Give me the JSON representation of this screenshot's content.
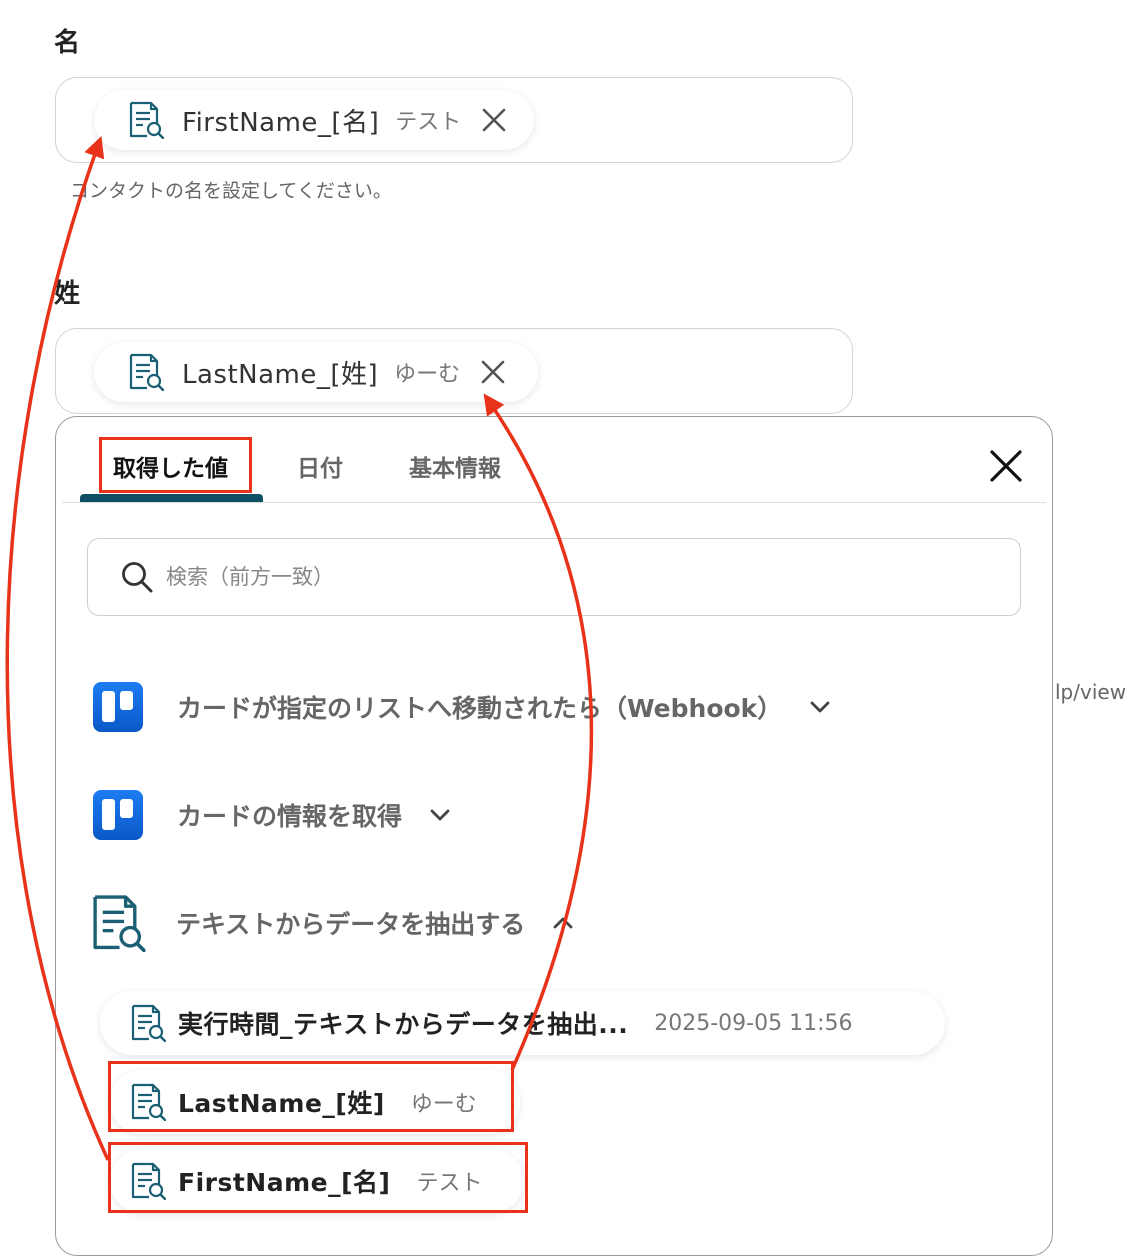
{
  "fields": {
    "first_name": {
      "label": "名",
      "chip_name": "FirstName_[名]",
      "chip_value": "テスト",
      "help": "コンタクトの名を設定してください。"
    },
    "last_name": {
      "label": "姓",
      "chip_name": "LastName_[姓]",
      "chip_value": "ゆーむ"
    }
  },
  "picker": {
    "tabs": [
      "取得した値",
      "日付",
      "基本情報"
    ],
    "active_tab": "取得した値",
    "search_placeholder": "検索（前方一致）",
    "sections": [
      {
        "title": "カードが指定のリストへ移動されたら（Webhook）",
        "icon": "trello-icon",
        "expanded": false
      },
      {
        "title": "カードの情報を取得",
        "icon": "trello-icon",
        "expanded": false
      },
      {
        "title": "テキストからデータを抽出する",
        "icon": "document-search-icon",
        "expanded": true
      }
    ],
    "outputs": [
      {
        "name": "実行時間_テキストからデータを抽出...",
        "value": "2025-09-05 11:56"
      },
      {
        "name": "LastName_[姓]",
        "value": "ゆーむ"
      },
      {
        "name": "FirstName_[名]",
        "value": "テスト"
      }
    ]
  },
  "background_text": "lp/view",
  "colors": {
    "annotation_red": "#e8321a",
    "tab_accent": "#0e4f66",
    "icon_teal": "#1a5f73",
    "trello_blue": "#0c66e4"
  }
}
